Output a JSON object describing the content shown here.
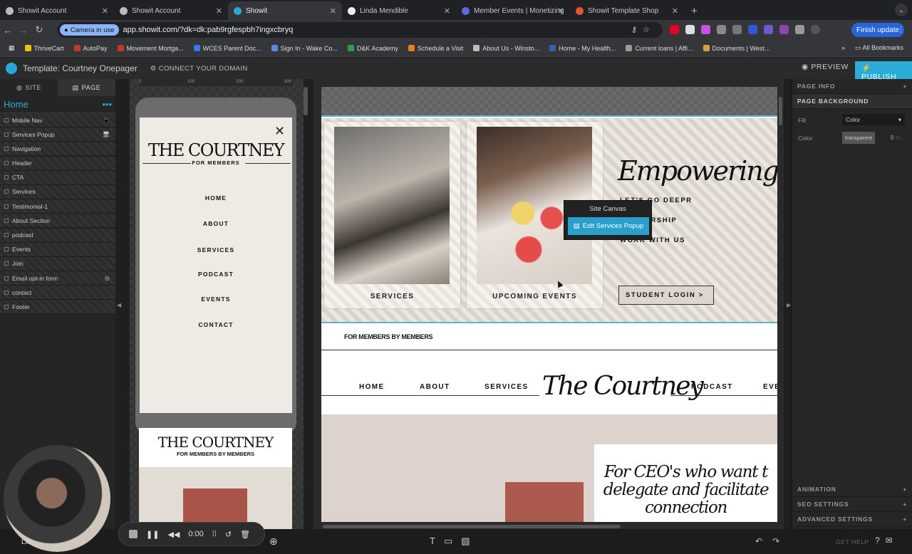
{
  "browser": {
    "tabs": [
      {
        "title": "",
        "fav": "#e8453c",
        "rec": true
      },
      {
        "title": "Showit Account",
        "fav": "#bbb"
      },
      {
        "title": "Showit Account",
        "fav": "#bbb"
      },
      {
        "title": "Showit",
        "fav": "#28a8d8",
        "active": true
      },
      {
        "title": "Linda Mendible",
        "fav": "#eee"
      },
      {
        "title": "Member Events | Monetizing",
        "fav": "#5b6bd6"
      },
      {
        "title": "Showit Template Shop",
        "fav": "#e4572e"
      }
    ],
    "camera_badge": "Camera in use",
    "url": "app.showit.com/?dk=dk:pab9rgfespbh7ingxcbryq",
    "finish_update": "Finish update",
    "bookmarks": [
      "ThriveCart",
      "AutoPay",
      "Movement Mortga...",
      "WCES Parent Doc...",
      "Sign In - Wake Co...",
      "D&K Academy",
      "Schedule a Visit",
      "About Us - Winsto...",
      "Home - My Health...",
      "Current loans | Affi...",
      "Documents | West..."
    ],
    "bookmark_colors": [
      "#f0c300",
      "#c0392b",
      "#c0392b",
      "#3b78e7",
      "#5a8dd6",
      "#2f9e44",
      "#e67e22",
      "#bbb",
      "#3b5fb0",
      "#999",
      "#d4a23a"
    ],
    "all_bookmarks": "All Bookmarks"
  },
  "showit": {
    "template_title": "Template: Courtney Onepager",
    "connect_domain": "CONNECT YOUR DOMAIN",
    "preview": "PREVIEW",
    "publish": "PUBLISH"
  },
  "left_panel": {
    "tab_site": "SITE",
    "tab_page": "PAGE",
    "page_name": "Home",
    "layers": [
      "Mobile Nav",
      "Services Popup",
      "Navigation",
      "Header",
      "CTA",
      "Services",
      "Testimonial-1",
      "About Section",
      "podcast",
      "Events",
      "Join",
      "Email opt-in form",
      "contact",
      "Footer"
    ]
  },
  "ruler": {
    "marks": [
      "0",
      "100",
      "200",
      "300"
    ]
  },
  "mobile": {
    "logo": "THE COURTNEY",
    "logo_sub": "FOR MEMBERS",
    "nav": [
      "HOME",
      "ABOUT",
      "SERVICES",
      "PODCAST",
      "EVENTS",
      "CONTACT"
    ],
    "below_logo": "THE COURTNEY",
    "below_sub": "FOR MEMBERS BY MEMBERS"
  },
  "desktop": {
    "card_services": "SERVICES",
    "card_events": "UPCOMING EVENTS",
    "headline": "Empowering Co",
    "links": [
      "LET'S GO DEEPR",
      "MEMBERSHIP",
      "WORK WITH US"
    ],
    "student_login": "STUDENT LOGIN >",
    "for_members": "FOR MEMBERS BY MEMBERS",
    "nav_left": [
      "HOME",
      "ABOUT",
      "SERVICES"
    ],
    "nav_logo": "The Courtney",
    "nav_right": [
      "PODCAST",
      "EVE"
    ],
    "ceo_lines": [
      "For CEO's who want t",
      "delegate and facilitate",
      "connection"
    ]
  },
  "tooltip": {
    "title": "Site Canvas",
    "button": "Edit Services Popup"
  },
  "right_panel": {
    "page_info": "PAGE INFO",
    "page_background": "PAGE BACKGROUND",
    "fill_label": "Fill",
    "fill_value": "Color",
    "color_label": "Color",
    "color_value": "transparent",
    "opacity": "0",
    "animation": "ANIMATION",
    "seo": "SEO SETTINGS",
    "advanced": "ADVANCED SETTINGS"
  },
  "bottom": {
    "recording_time": "0:00",
    "get_help": "GET HELP",
    "user_name": "Lin"
  }
}
